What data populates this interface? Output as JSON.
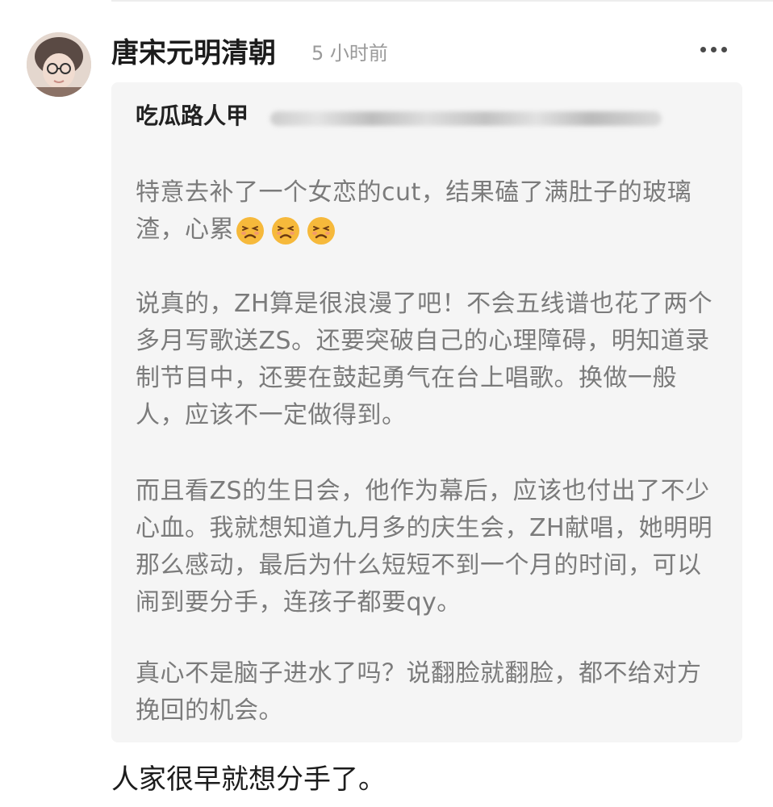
{
  "comment": {
    "username": "唐宋元明清朝",
    "timestamp": "5 小时前",
    "avatar_icon": "user-avatar",
    "more_icon": "more-horizontal-icon",
    "quote": {
      "author": "吃瓜路人甲",
      "paragraphs": [
        "特意去补了一个女恋的cut，结果磕了满肚子的玻璃渣，心累",
        "说真的，ZH算是很浪漫了吧！不会五线谱也花了两个多月写歌送ZS。还要突破自己的心理障碍，明知道录制节目中，还要在鼓起勇气在台上唱歌。换做一般人，应该不一定做得到。",
        "而且看ZS的生日会，他作为幕后，应该也付出了不少心血。我就想知道九月多的庆生会，ZH献唱，她明明那么感动，最后为什么短短不到一个月的时间，可以闹到要分手，连孩子都要qy。",
        "真心不是脑子进水了吗？说翻脸就翻脸，都不给对方挽回的机会。"
      ],
      "emoji_name": "tired-face-emoji",
      "emoji_count": 3
    },
    "reply": "人家很早就想分手了。"
  }
}
